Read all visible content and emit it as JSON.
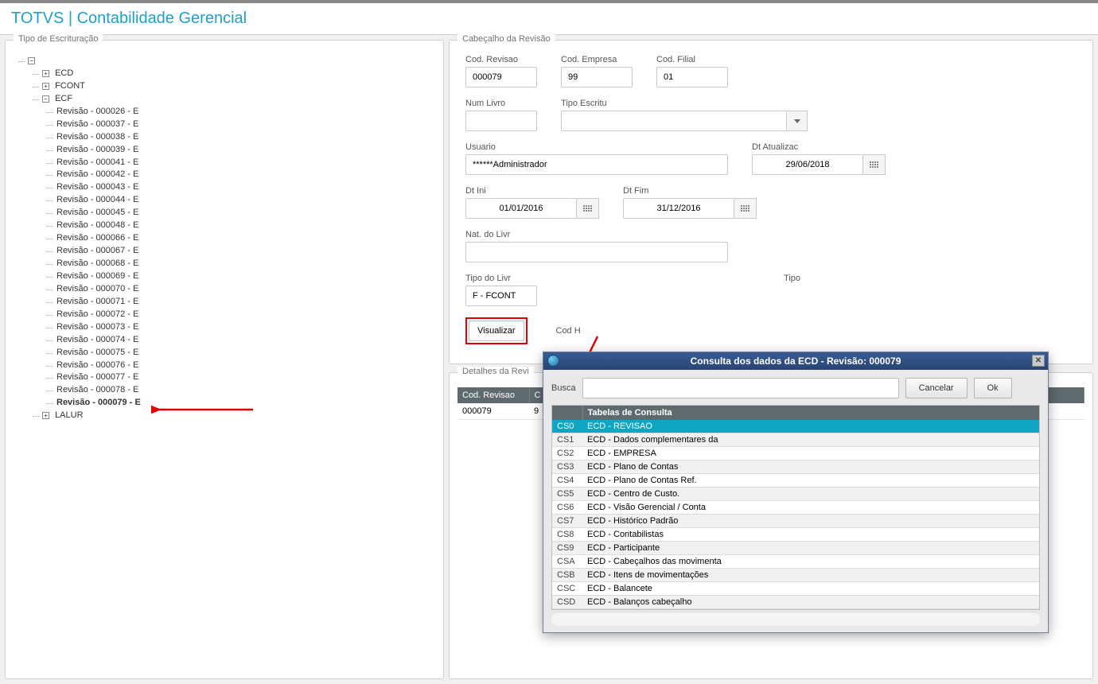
{
  "app": {
    "title": "TOTVS | Contabilidade Gerencial"
  },
  "panels": {
    "tree_title": "Tipo de Escrituração",
    "header_title": "Cabeçalho da Revisão",
    "details_title": "Detalhes da Revi"
  },
  "tree": {
    "root": [
      {
        "label": "ECD",
        "children": []
      },
      {
        "label": "FCONT",
        "children": []
      },
      {
        "label": "ECF",
        "children_leaf": [
          "Revisão - 000026 - E",
          "Revisão - 000037 - E",
          "Revisão - 000038 - E",
          "Revisão - 000039 - E",
          "Revisão - 000041 - E",
          "Revisão - 000042 - E",
          "Revisão - 000043 - E",
          "Revisão - 000044 - E",
          "Revisão - 000045 - E",
          "Revisão - 000048 - E",
          "Revisão - 000066 - E",
          "Revisão - 000067 - E",
          "Revisão - 000068 - E",
          "Revisão - 000069 - E",
          "Revisão - 000070 - E",
          "Revisão - 000071 - E",
          "Revisão - 000072 - E",
          "Revisão - 000073 - E",
          "Revisão - 000074 - E",
          "Revisão - 000075 - E",
          "Revisão - 000076 - E",
          "Revisão - 000077 - E",
          "Revisão - 000078 - E",
          "Revisão - 000079 - E"
        ],
        "selected_index": 23
      },
      {
        "label": "LALUR",
        "children": []
      }
    ]
  },
  "form": {
    "cod_revisao": {
      "label": "Cod. Revisao",
      "value": "000079"
    },
    "cod_empresa": {
      "label": "Cod. Empresa",
      "value": "99"
    },
    "cod_filial": {
      "label": "Cod. Filial",
      "value": "01"
    },
    "num_livro": {
      "label": "Num Livro",
      "value": ""
    },
    "tipo_escritu": {
      "label": "Tipo Escritu",
      "value": ""
    },
    "usuario": {
      "label": "Usuario",
      "value": "******Administrador"
    },
    "dt_atualizac": {
      "label": "Dt Atualizac",
      "value": "29/06/2018"
    },
    "dt_ini": {
      "label": "Dt Ini",
      "value": "01/01/2016"
    },
    "dt_fim": {
      "label": "Dt Fim",
      "value": "31/12/2016"
    },
    "nat_do_livr": {
      "label": "Nat. do Livr",
      "value": ""
    },
    "tipo_do_livr": {
      "label": "Tipo do Livr",
      "value": "F - FCONT"
    },
    "tipo": {
      "label": "Tipo"
    }
  },
  "buttons": {
    "visualizar": "Visualizar",
    "post_visualizar": "Cod H"
  },
  "details": {
    "cols": [
      "Cod. Revisao",
      "C"
    ],
    "row": [
      "000079",
      "9"
    ]
  },
  "modal": {
    "title": "Consulta dos dados da ECD - Revisão: 000079",
    "buscar_label": "Busca",
    "buscar_value": "",
    "cancelar": "Cancelar",
    "ok": "Ok",
    "col_header": "Tabelas de Consulta",
    "rows": [
      {
        "code": "CS0",
        "desc": "ECD - REVISAO",
        "selected": true
      },
      {
        "code": "CS1",
        "desc": "ECD - Dados complementares da"
      },
      {
        "code": "CS2",
        "desc": "ECD - EMPRESA"
      },
      {
        "code": "CS3",
        "desc": "ECD - Plano de Contas"
      },
      {
        "code": "CS4",
        "desc": "ECD - Plano de Contas Ref."
      },
      {
        "code": "CS5",
        "desc": "ECD - Centro de Custo."
      },
      {
        "code": "CS6",
        "desc": "ECD - Visão Gerencial / Conta"
      },
      {
        "code": "CS7",
        "desc": "ECD - Histórico Padrão"
      },
      {
        "code": "CS8",
        "desc": "ECD - Contabilistas"
      },
      {
        "code": "CS9",
        "desc": "ECD - Participante"
      },
      {
        "code": "CSA",
        "desc": "ECD - Cabeçalhos das movimenta"
      },
      {
        "code": "CSB",
        "desc": "ECD - Itens de movimentações"
      },
      {
        "code": "CSC",
        "desc": "ECD - Balancete"
      },
      {
        "code": "CSD",
        "desc": "ECD - Balanços cabeçalho"
      }
    ]
  }
}
